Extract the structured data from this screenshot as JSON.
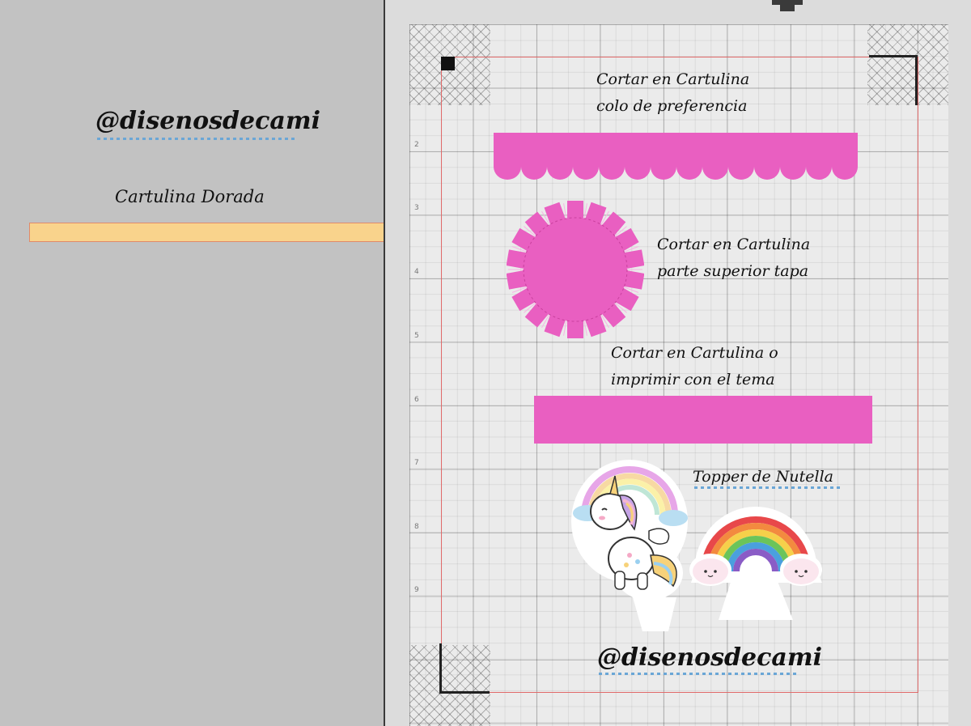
{
  "left_panel": {
    "handle": "@disenosdecami",
    "gold_label": "Cartulina Dorada"
  },
  "canvas": {
    "ruler_numbers": [
      "2",
      "3",
      "4",
      "5",
      "6",
      "7",
      "8",
      "9"
    ],
    "label_top": [
      "Cortar en Cartulina",
      "colo de preferencia"
    ],
    "label_circle": [
      "Cortar en Cartulina",
      "parte superior tapa"
    ],
    "label_band": [
      "Cortar en Cartulina o",
      "imprimir con el tema"
    ],
    "topper_label": "Topper de Nutella",
    "handle": "@disenosdecami"
  },
  "colors": {
    "pink": "#e95fc1",
    "gold": "#f9d38c",
    "mat": "#ebebeb",
    "cut_border": "#e06a6a"
  },
  "icons": {
    "unicorn": "unicorn-rainbow-sticker",
    "rainbow": "rainbow-clouds-sticker"
  }
}
